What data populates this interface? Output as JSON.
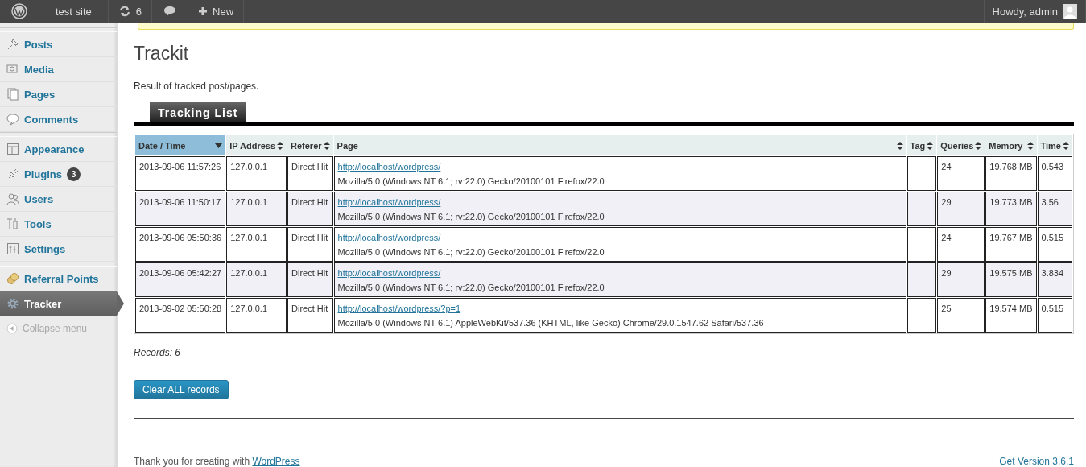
{
  "admin_bar": {
    "site": "test site",
    "updates": "6",
    "new": "New",
    "greeting": "Howdy, admin"
  },
  "sidebar": {
    "items": [
      {
        "label": "Posts",
        "selected": false,
        "separator_before": true
      },
      {
        "label": "Media",
        "selected": false,
        "separator_before": false
      },
      {
        "label": "Pages",
        "selected": false,
        "separator_before": false
      },
      {
        "label": "Comments",
        "selected": false,
        "separator_before": false
      },
      {
        "label": "Appearance",
        "selected": false,
        "separator_before": true
      },
      {
        "label": "Plugins",
        "selected": false,
        "separator_before": false,
        "badge": "3"
      },
      {
        "label": "Users",
        "selected": false,
        "separator_before": false
      },
      {
        "label": "Tools",
        "selected": false,
        "separator_before": false
      },
      {
        "label": "Settings",
        "selected": false,
        "separator_before": false
      },
      {
        "label": "Referral Points",
        "selected": false,
        "separator_before": true
      },
      {
        "label": "Tracker",
        "selected": true,
        "separator_before": false
      }
    ],
    "collapse": "Collapse menu"
  },
  "page": {
    "title": "Trackit",
    "description": "Result of tracked post/pages.",
    "tab": "Tracking List"
  },
  "table": {
    "columns": [
      {
        "label": "Date / Time",
        "sorted": true
      },
      {
        "label": "IP Address",
        "sorted": false
      },
      {
        "label": "Referer",
        "sorted": false
      },
      {
        "label": "Page",
        "sorted": false
      },
      {
        "label": "Tag",
        "sorted": false
      },
      {
        "label": "Queries",
        "sorted": false
      },
      {
        "label": "Memory",
        "sorted": false
      },
      {
        "label": "Time",
        "sorted": false
      }
    ],
    "rows": [
      {
        "date": "2013-09-06 11:57:26",
        "ip": "127.0.0.1",
        "referer": "Direct Hit",
        "page_url": "http://localhost/wordpress/",
        "user_agent": "Mozilla/5.0 (Windows NT 6.1; rv:22.0) Gecko/20100101 Firefox/22.0",
        "queries": "24",
        "memory": "19.768 MB",
        "time": "0.543"
      },
      {
        "date": "2013-09-06 11:50:17",
        "ip": "127.0.0.1",
        "referer": "Direct Hit",
        "page_url": "http://localhost/wordpress/",
        "user_agent": "Mozilla/5.0 (Windows NT 6.1; rv:22.0) Gecko/20100101 Firefox/22.0",
        "queries": "29",
        "memory": "19.773 MB",
        "time": "3.56"
      },
      {
        "date": "2013-09-06 05:50:36",
        "ip": "127.0.0.1",
        "referer": "Direct Hit",
        "page_url": "http://localhost/wordpress/",
        "user_agent": "Mozilla/5.0 (Windows NT 6.1; rv:22.0) Gecko/20100101 Firefox/22.0",
        "queries": "24",
        "memory": "19.767 MB",
        "time": "0.515"
      },
      {
        "date": "2013-09-06 05:42:27",
        "ip": "127.0.0.1",
        "referer": "Direct Hit",
        "page_url": "http://localhost/wordpress/",
        "user_agent": "Mozilla/5.0 (Windows NT 6.1; rv:22.0) Gecko/20100101 Firefox/22.0",
        "queries": "29",
        "memory": "19.575 MB",
        "time": "3.834"
      },
      {
        "date": "2013-09-02 05:50:28",
        "ip": "127.0.0.1",
        "referer": "Direct Hit",
        "page_url": "http://localhost/wordpress/?p=1",
        "user_agent": "Mozilla/5.0 (Windows NT 6.1) AppleWebKit/537.36 (KHTML, like Gecko) Chrome/29.0.1547.62 Safari/537.36",
        "queries": "25",
        "memory": "19.574 MB",
        "time": "0.515"
      }
    ]
  },
  "records": "Records: 6",
  "clear_button": "Clear ALL records",
  "footer": {
    "thanks": "Thank you for creating with ",
    "link": "WordPress",
    "version": "Get Version 3.6.1"
  }
}
